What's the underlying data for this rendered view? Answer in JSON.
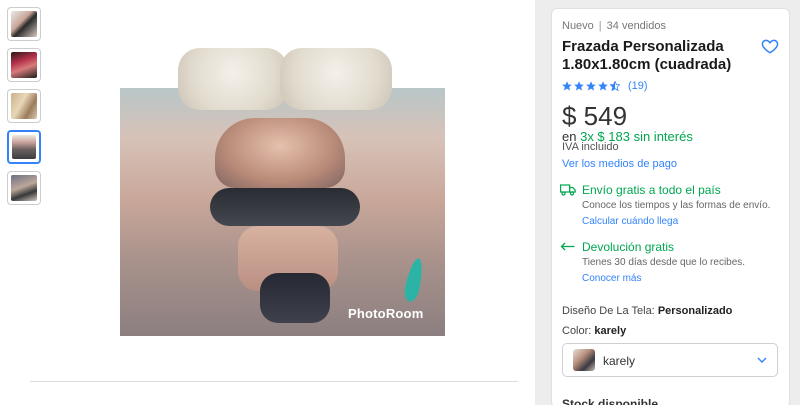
{
  "gallery": {
    "thumbnails": [
      {
        "icon": "thumbnail-image-1"
      },
      {
        "icon": "thumbnail-image-2"
      },
      {
        "icon": "thumbnail-image-3"
      },
      {
        "icon": "thumbnail-image-4",
        "active": true
      },
      {
        "icon": "thumbnail-image-5"
      }
    ],
    "watermark": "PhotoRoom"
  },
  "product": {
    "condition": "Nuevo",
    "separator": "|",
    "sold": "34 vendidos",
    "title": "Frazada Personalizada 1.80x1.80cm (cuadrada)",
    "rating": 4.5,
    "reviews": "(19)",
    "price": "$ 549",
    "installments_prefix": "en",
    "installments_offer": "3x $ 183 sin interés",
    "tax": "IVA incluido",
    "payment_link": "Ver los medios de pago"
  },
  "shipping": {
    "title": "Envío gratis a todo el país",
    "description": "Conoce los tiempos y las formas de envío.",
    "link": "Calcular cuándo llega"
  },
  "returns": {
    "title": "Devolución gratis",
    "description": "Tienes 30 días desde que lo recibes.",
    "link": "Conocer más"
  },
  "attributes": {
    "design_label": "Diseño De La Tela:",
    "design_value": "Personalizado",
    "color_label": "Color:",
    "color_value": "karely"
  },
  "variant_select": {
    "selected": "karely"
  },
  "stock": "Stock disponible",
  "colors": {
    "accent": "#3483fa",
    "green": "#00a650"
  }
}
